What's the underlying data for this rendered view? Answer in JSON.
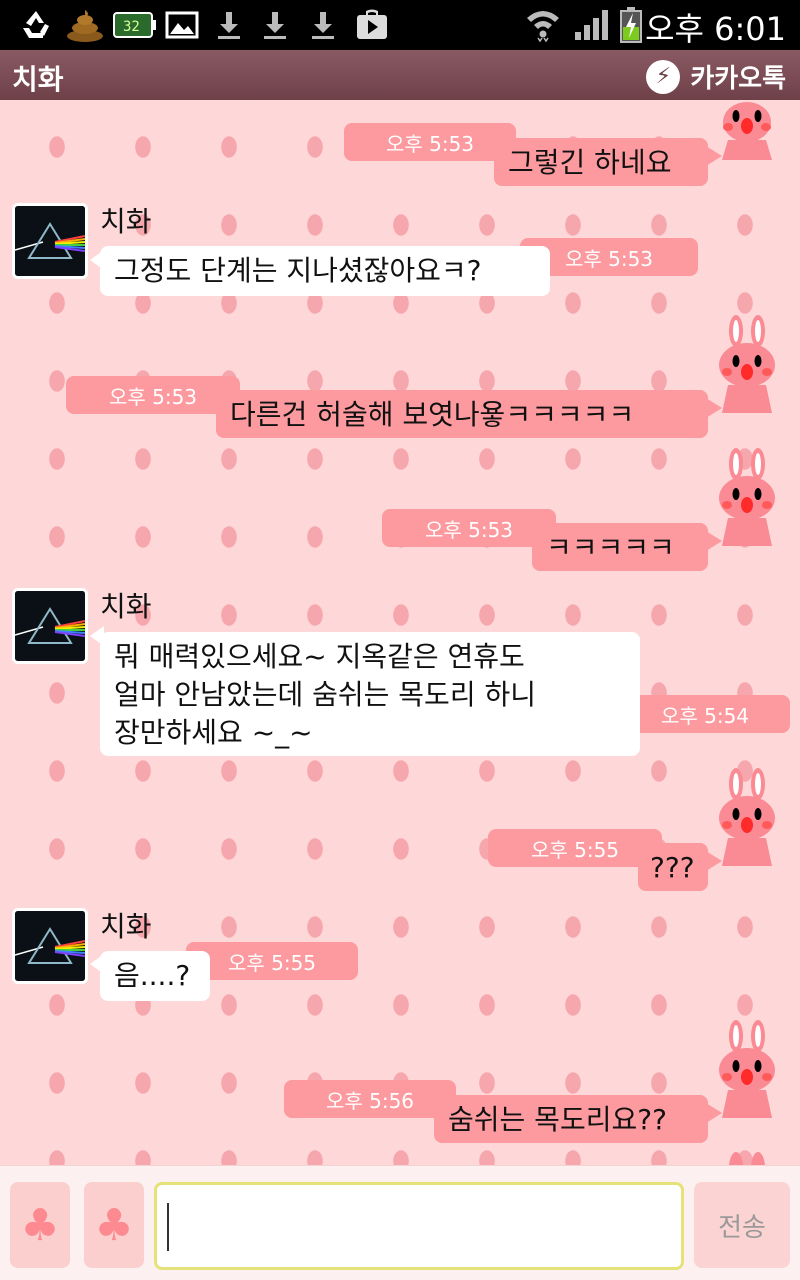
{
  "status_bar": {
    "time": "오후 6:01",
    "battery_level": "32",
    "icons": [
      "recycle-icon",
      "poop-icon",
      "battery-widget-icon",
      "image-icon",
      "download-icon",
      "download-icon",
      "download-icon",
      "play-store-icon",
      "wifi-icon",
      "signal-icon",
      "battery-charging-icon"
    ]
  },
  "title_bar": {
    "title": "치화",
    "brand": "카카오톡"
  },
  "chat": {
    "sender_name": "치화",
    "messages": [
      {
        "from": "me",
        "time": "오후 5:53",
        "lines": [
          "그렇긴 하네요"
        ]
      },
      {
        "from": "other",
        "time": "오후 5:53",
        "lines": [
          "그정도 단계는 지나셨잖아요ㅋ?"
        ]
      },
      {
        "from": "me",
        "time": "오후 5:53",
        "lines": [
          "다른건 허술해 보엿나욯ㅋㅋㅋㅋㅋ"
        ]
      },
      {
        "from": "me",
        "time": "오후 5:53",
        "lines": [
          "ㅋㅋㅋㅋㅋ"
        ]
      },
      {
        "from": "other",
        "time": "오후 5:54",
        "lines": [
          "뭐 매력있으세요~ 지옥같은 연휴도",
          "얼마 안남았는데 숨쉬는 목도리 하니",
          "장만하세요 ~_~"
        ]
      },
      {
        "from": "me",
        "time": "오후 5:55",
        "lines": [
          "???"
        ]
      },
      {
        "from": "other",
        "time": "오후 5:55",
        "lines": [
          "음....?"
        ]
      },
      {
        "from": "me",
        "time": "오후 5:56",
        "lines": [
          "숨쉬는 목도리요??"
        ]
      }
    ]
  },
  "input_bar": {
    "input_value": "",
    "send_label": "전송"
  },
  "colors": {
    "background": "#fed8d8",
    "dots": "#f6a7ae",
    "my_bubble": "#fc9a9f",
    "other_bubble": "#ffffff",
    "title_bar": "#7a4c54",
    "input_border": "#e6e27a"
  }
}
